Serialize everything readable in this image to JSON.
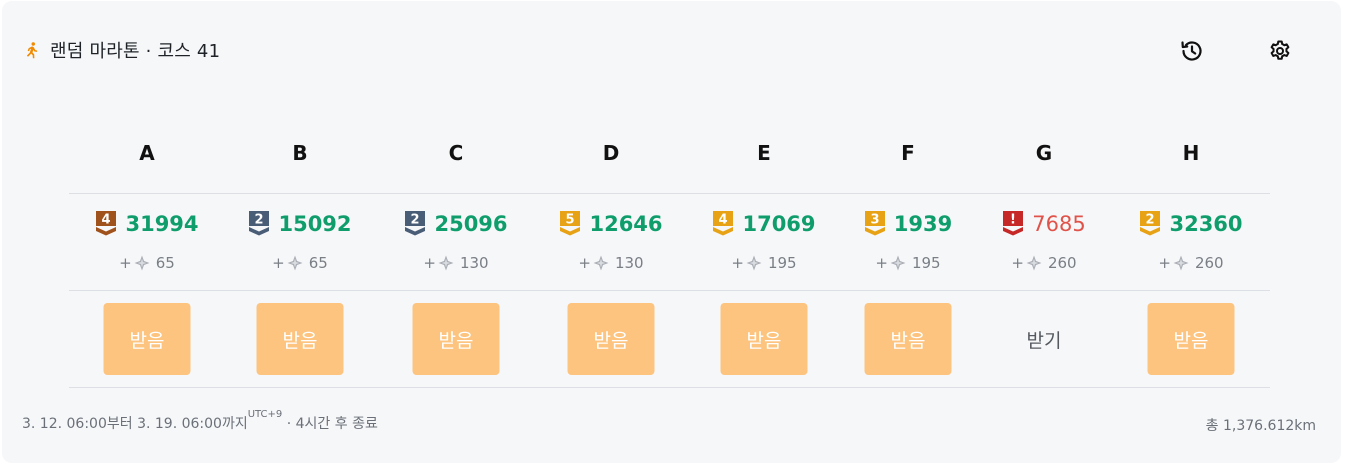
{
  "header": {
    "runner_icon": "running-person-icon",
    "title": "랜덤 마라톤 · 코스 41",
    "history_icon": "history-icon",
    "settings_icon": "gear-icon"
  },
  "colors": {
    "score_green": "#0f9d6b",
    "score_red": "#e0534a",
    "claim_bg": "#fcc47f",
    "badge_bronze": "#a0521d",
    "badge_slate": "#4a5d77",
    "badge_gold": "#e8a215",
    "badge_red": "#c62828"
  },
  "problems": [
    {
      "letter": "A",
      "tier": "4",
      "tier_color": "bronze",
      "score": "31994",
      "reward_prefix": "+",
      "reward_value": "65",
      "action": "받음",
      "claimed": true
    },
    {
      "letter": "B",
      "tier": "2",
      "tier_color": "slate",
      "score": "15092",
      "reward_prefix": "+",
      "reward_value": "65",
      "action": "받음",
      "claimed": true
    },
    {
      "letter": "C",
      "tier": "2",
      "tier_color": "slate",
      "score": "25096",
      "reward_prefix": "+",
      "reward_value": "130",
      "action": "받음",
      "claimed": true
    },
    {
      "letter": "D",
      "tier": "5",
      "tier_color": "gold",
      "score": "12646",
      "reward_prefix": "+",
      "reward_value": "130",
      "action": "받음",
      "claimed": true
    },
    {
      "letter": "E",
      "tier": "4",
      "tier_color": "gold",
      "score": "17069",
      "reward_prefix": "+",
      "reward_value": "195",
      "action": "받음",
      "claimed": true
    },
    {
      "letter": "F",
      "tier": "3",
      "tier_color": "gold",
      "score": "1939",
      "reward_prefix": "+",
      "reward_value": "195",
      "action": "받음",
      "claimed": true
    },
    {
      "letter": "G",
      "tier": "!",
      "tier_color": "red",
      "score": "7685",
      "reward_prefix": "+",
      "reward_value": "260",
      "action": "받기",
      "claimed": false
    },
    {
      "letter": "H",
      "tier": "2",
      "tier_color": "gold",
      "score": "32360",
      "reward_prefix": "+",
      "reward_value": "260",
      "action": "받음",
      "claimed": true
    }
  ],
  "footer": {
    "period": "3. 12. 06:00부터 3. 19. 06:00까지",
    "timezone": "UTC+9",
    "remaining": " · 4시간 후 종료",
    "total": "총 1,376.612km"
  }
}
